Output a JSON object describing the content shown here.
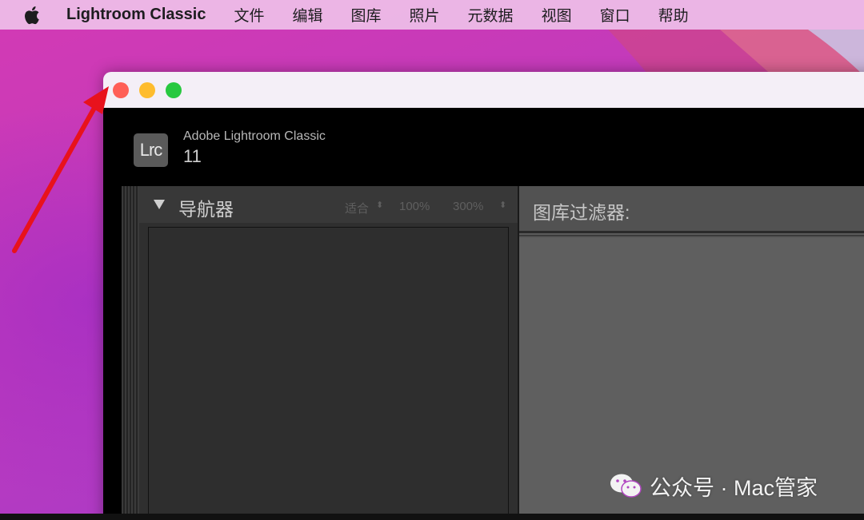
{
  "menubar": {
    "app_name": "Lightroom Classic",
    "items": [
      "文件",
      "编辑",
      "图库",
      "照片",
      "元数据",
      "视图",
      "窗口",
      "帮助"
    ]
  },
  "window": {
    "logo_text": "Lrc",
    "product_name": "Adobe Lightroom Classic",
    "product_version": "11"
  },
  "navigator": {
    "title": "导航器",
    "zoom_options": [
      "适合",
      "100%",
      "300%"
    ]
  },
  "library_filter": {
    "title": "图库过滤器:"
  },
  "watermark": {
    "text": "公众号 · Mac管家"
  },
  "colors": {
    "close": "#ff5f57",
    "minimize": "#febc2e",
    "zoom": "#28c840",
    "annotation": "#e8121c"
  },
  "icons": [
    "apple-icon",
    "disclosure-triangle-icon",
    "wechat-icon"
  ]
}
